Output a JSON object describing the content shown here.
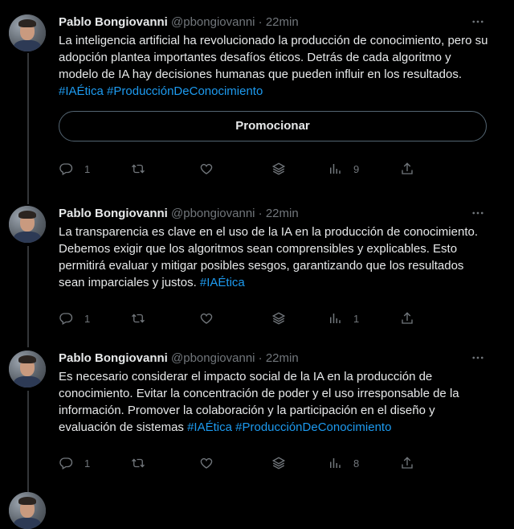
{
  "tweets": [
    {
      "author": "Pablo Bongiovanni",
      "handle": "@pbongiovanni",
      "separator": "·",
      "time": "22min",
      "text_parts": [
        {
          "text": "La inteligencia artificial ha revolucionado la producción de conocimiento, pero su adopción plantea importantes desafíos éticos. Detrás de cada algoritmo y modelo de IA hay decisiones humanas que pueden influir en los resultados. ",
          "hashtag": false
        },
        {
          "text": "#IAÉtica",
          "hashtag": true
        },
        {
          "text": " ",
          "hashtag": false
        },
        {
          "text": "#ProducciónDeConocimiento",
          "hashtag": true
        }
      ],
      "promote_label": "Promocionar",
      "replies": "1",
      "retweets": "",
      "likes": "",
      "views": "9"
    },
    {
      "author": "Pablo Bongiovanni",
      "handle": "@pbongiovanni",
      "separator": "·",
      "time": "22min",
      "text_parts": [
        {
          "text": "La transparencia es clave en el uso de la IA en la producción de conocimiento. Debemos exigir que los algoritmos sean comprensibles y explicables. Esto permitirá evaluar y mitigar posibles sesgos, garantizando que los resultados sean imparciales y justos. ",
          "hashtag": false
        },
        {
          "text": "#IAÉtica",
          "hashtag": true
        }
      ],
      "replies": "1",
      "retweets": "",
      "likes": "",
      "views": "1"
    },
    {
      "author": "Pablo Bongiovanni",
      "handle": "@pbongiovanni",
      "separator": "·",
      "time": "22min",
      "text_parts": [
        {
          "text": "Es necesario considerar el impacto social de la IA en la producción de conocimiento. Evitar la concentración de poder y el uso irresponsable de la información. Promover la colaboración y la participación en el diseño y evaluación de sistemas ",
          "hashtag": false
        },
        {
          "text": "#IAÉtica",
          "hashtag": true
        },
        {
          "text": " ",
          "hashtag": false
        },
        {
          "text": "#ProducciónDeConocimiento",
          "hashtag": true
        }
      ],
      "replies": "1",
      "retweets": "",
      "likes": "",
      "views": "8"
    }
  ],
  "icons": {
    "more": "more-horizontal-icon",
    "reply": "reply-icon",
    "retweet": "retweet-icon",
    "like": "heart-icon",
    "bookmark": "stack-icon",
    "views": "views-bar-chart-icon",
    "share": "share-icon"
  },
  "colors": {
    "background": "#000000",
    "text": "#e7e9ea",
    "muted": "#71767b",
    "link": "#1d9bf0",
    "border": "#536471"
  }
}
